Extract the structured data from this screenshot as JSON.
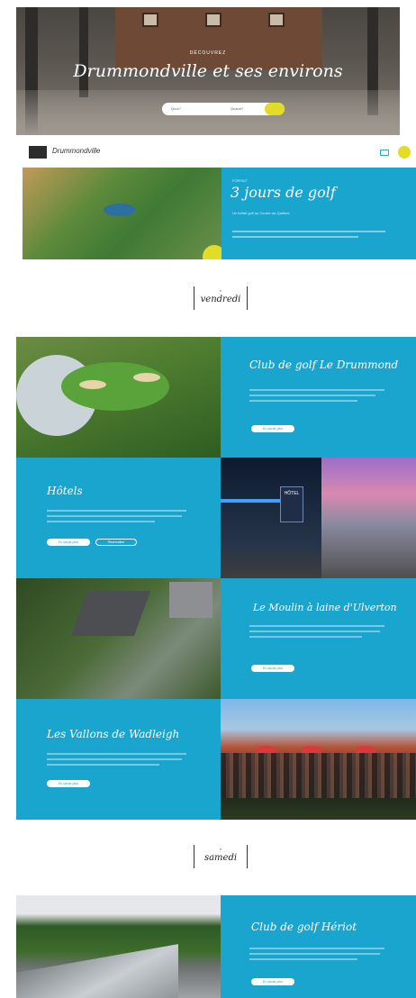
{
  "hero": {
    "kicker": "DÉCOUVREZ",
    "title": "Drummondville et ses environs",
    "search_field_1": "Quoi?",
    "search_field_2": "Quand?"
  },
  "header": {
    "logo_alt": "DRUMMOND",
    "brand": "Drummondville"
  },
  "intro": {
    "small": "FORFAIT",
    "title": "3 jours de golf",
    "subtitle": "Un forfait golf au Centre-du-Québec"
  },
  "days": [
    {
      "label": "vendredi"
    },
    {
      "label": "samedi"
    }
  ],
  "items": [
    {
      "title": "Club de golf Le Drummond",
      "btn1": "En savoir plus"
    },
    {
      "title": "Hôtels",
      "btn1": "En savoir plus",
      "btn2": "Réservation"
    },
    {
      "title": "Le Moulin à laine d'Ulverton",
      "btn1": "En savoir plus"
    },
    {
      "title": "Les Vallons de Wadleigh",
      "btn1": "En savoir plus"
    },
    {
      "title": "Club de golf Hériot",
      "btn1": "En savoir plus"
    }
  ],
  "hotel_sign": "HÔTEL",
  "colors": {
    "accent": "#1aa5cf",
    "yellow": "#e3dc27"
  }
}
